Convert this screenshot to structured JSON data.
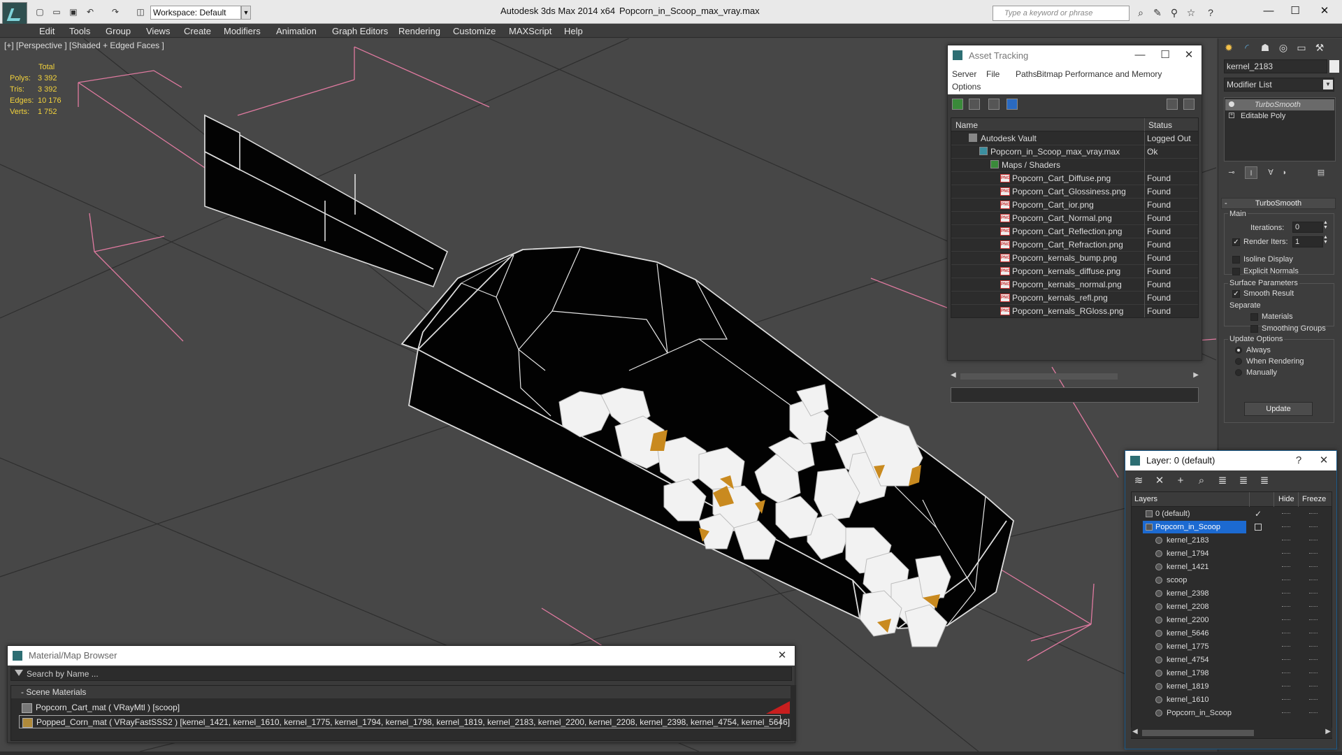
{
  "title_bar": {
    "app_name": "Autodesk 3ds Max  2014 x64",
    "file_name": "Popcorn_in_Scoop_max_vray.max",
    "workspace": "Workspace: Default",
    "search_placeholder": "Type a keyword or phrase"
  },
  "menu": [
    "Edit",
    "Tools",
    "Group",
    "Views",
    "Create",
    "Modifiers",
    "Animation",
    "Graph Editors",
    "Rendering",
    "Customize",
    "MAXScript",
    "Help"
  ],
  "viewport": {
    "label": "[+] [Perspective ] [Shaded + Edged Faces ]",
    "stats_header": "Total",
    "stats": [
      {
        "label": "Polys:",
        "value": "3 392"
      },
      {
        "label": "Tris:",
        "value": "3 392"
      },
      {
        "label": "Edges:",
        "value": "10 176"
      },
      {
        "label": "Verts:",
        "value": "1 752"
      }
    ]
  },
  "asset_tracking": {
    "title": "Asset Tracking",
    "menu": [
      "Server",
      "File",
      "Paths",
      "Bitmap Performance and Memory",
      "Options"
    ],
    "columns": [
      "Name",
      "Status"
    ],
    "rows": [
      {
        "name": "Autodesk Vault",
        "status": "Logged Out ..."
      },
      {
        "name": "Popcorn_in_Scoop_max_vray.max",
        "status": "Ok"
      },
      {
        "name": "Maps / Shaders",
        "status": ""
      },
      {
        "name": "Popcorn_Cart_Diffuse.png",
        "status": "Found"
      },
      {
        "name": "Popcorn_Cart_Glossiness.png",
        "status": "Found"
      },
      {
        "name": "Popcorn_Cart_ior.png",
        "status": "Found"
      },
      {
        "name": "Popcorn_Cart_Normal.png",
        "status": "Found"
      },
      {
        "name": "Popcorn_Cart_Reflection.png",
        "status": "Found"
      },
      {
        "name": "Popcorn_Cart_Refraction.png",
        "status": "Found"
      },
      {
        "name": "Popcorn_kernals_bump.png",
        "status": "Found"
      },
      {
        "name": "Popcorn_kernals_diffuse.png",
        "status": "Found"
      },
      {
        "name": "Popcorn_kernals_normal.png",
        "status": "Found"
      },
      {
        "name": "Popcorn_kernals_refl.png",
        "status": "Found"
      },
      {
        "name": "Popcorn_kernals_RGloss.png",
        "status": "Found"
      }
    ],
    "png_icon_text": "PNG"
  },
  "command_panel": {
    "object_name": "kernel_2183",
    "modifier_list": "Modifier List",
    "stack": [
      "TurboSmooth",
      "Editable Poly"
    ],
    "rollout": "TurboSmooth",
    "main_label": "Main",
    "iterations_label": "Iterations:",
    "iterations_value": "0",
    "render_iters_label": "Render Iters:",
    "render_iters_value": "1",
    "isoline_display": "Isoline Display",
    "explicit_normals": "Explicit Normals",
    "surface_parameters": "Surface Parameters",
    "smooth_result": "Smooth Result",
    "separate": "Separate",
    "materials": "Materials",
    "smoothing_groups": "Smoothing Groups",
    "update_options": "Update Options",
    "always": "Always",
    "when_rendering": "When Rendering",
    "manually": "Manually",
    "update_button": "Update"
  },
  "layer_window": {
    "title": "Layer: 0 (default)",
    "help": "?",
    "columns": [
      "Layers",
      "Hide",
      "Freeze"
    ],
    "rows": [
      "0 (default)",
      "Popcorn_in_Scoop",
      "kernel_2183",
      "kernel_1794",
      "kernel_1421",
      "scoop",
      "kernel_2398",
      "kernel_2208",
      "kernel_2200",
      "kernel_5646",
      "kernel_1775",
      "kernel_4754",
      "kernel_1798",
      "kernel_1819",
      "kernel_1610",
      "Popcorn_in_Scoop"
    ]
  },
  "material_browser": {
    "title": "Material/Map Browser",
    "search_placeholder": "Search by Name ...",
    "group": "- Scene Materials",
    "items": [
      "Popcorn_Cart_mat  ( VRayMtl ) [scoop]",
      "Popped_Corn_mat  ( VRayFastSSS2 ) [kernel_1421, kernel_1610, kernel_1775, kernel_1794, kernel_1798, kernel_1819, kernel_2183, kernel_2200, kernel_2208, kernel_2398, kernel_4754, kernel_5646]"
    ]
  },
  "colors": {
    "viewport_bg": "#474747",
    "stats_text": "#f2d23c",
    "selection": "#1c6ad1",
    "wire_pink": "#e07aa0"
  }
}
